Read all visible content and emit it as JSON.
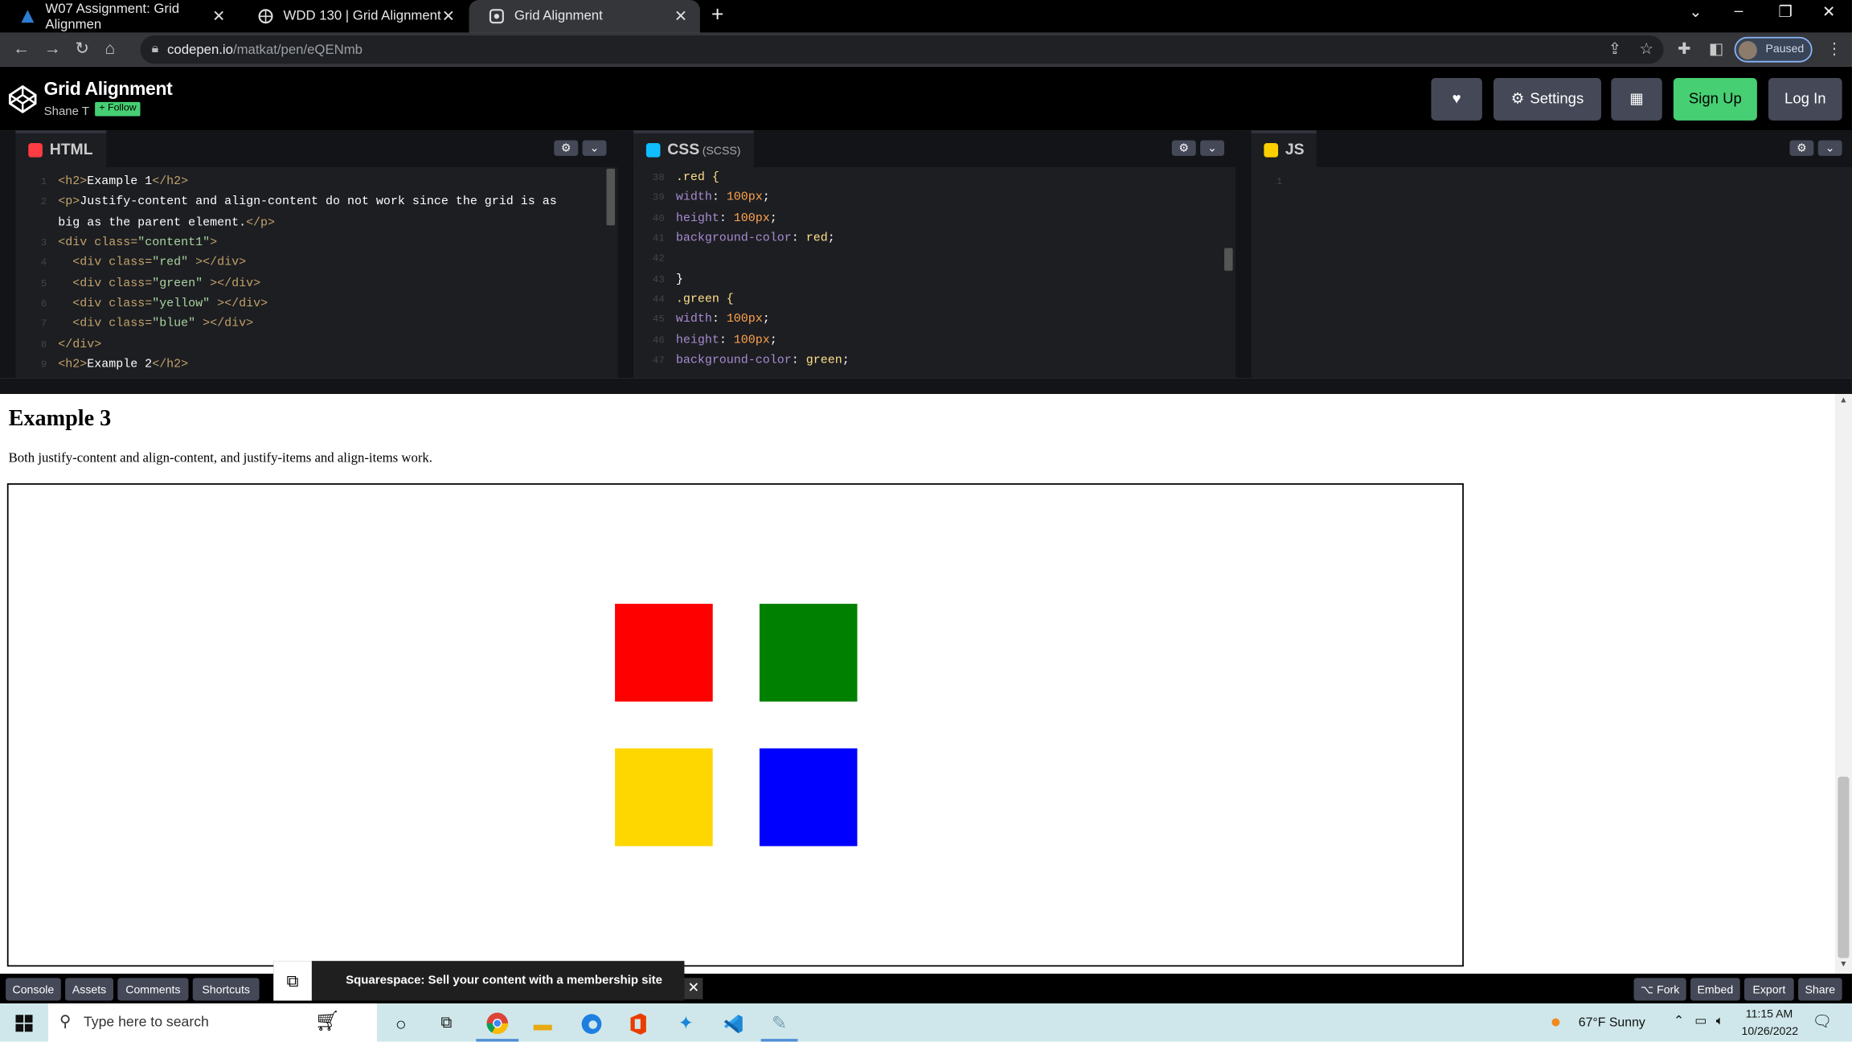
{
  "browser": {
    "tabs": [
      {
        "title": "W07 Assignment: Grid Alignmen"
      },
      {
        "title": "WDD 130 | Grid Alignment"
      },
      {
        "title": "Grid Alignment"
      }
    ],
    "url_host": "codepen.io",
    "url_path": "/matkat/pen/eQENmb",
    "profile_status": "Paused"
  },
  "codepen": {
    "title": "Grid Alignment",
    "author": "Shane T",
    "follow_label": "+ Follow",
    "settings_label": "Settings",
    "signup_label": "Sign Up",
    "login_label": "Log In",
    "html_tab": "HTML",
    "css_tab": "CSS",
    "css_sub": "(SCSS)",
    "js_tab": "JS"
  },
  "html_code": [
    {
      "ln": "1",
      "parts": [
        [
          "tag",
          "<h2>"
        ],
        [
          "txt",
          "Example 1"
        ],
        [
          "tag",
          "</h2>"
        ]
      ]
    },
    {
      "ln": "2",
      "parts": [
        [
          "tag",
          "<p>"
        ],
        [
          "txt",
          "Justify-content and align-content do not work since the grid is as"
        ]
      ]
    },
    {
      "ln": "",
      "parts": [
        [
          "txt",
          "big as the parent element."
        ],
        [
          "tag",
          "</p>"
        ]
      ]
    },
    {
      "ln": "3",
      "parts": [
        [
          "tag",
          "<div "
        ],
        [
          "attr",
          "class="
        ],
        [
          "str",
          "\"content1\""
        ],
        [
          "tag",
          ">"
        ]
      ]
    },
    {
      "ln": "4",
      "parts": [
        [
          "tag",
          "  <div "
        ],
        [
          "attr",
          "class="
        ],
        [
          "str",
          "\"red\""
        ],
        [
          "tag",
          " ></div>"
        ]
      ]
    },
    {
      "ln": "5",
      "parts": [
        [
          "tag",
          "  <div "
        ],
        [
          "attr",
          "class="
        ],
        [
          "str",
          "\"green\""
        ],
        [
          "tag",
          " ></div>"
        ]
      ]
    },
    {
      "ln": "6",
      "parts": [
        [
          "tag",
          "  <div "
        ],
        [
          "attr",
          "class="
        ],
        [
          "str",
          "\"yellow\""
        ],
        [
          "tag",
          " ></div>"
        ]
      ]
    },
    {
      "ln": "7",
      "parts": [
        [
          "tag",
          "  <div "
        ],
        [
          "attr",
          "class="
        ],
        [
          "str",
          "\"blue\""
        ],
        [
          "tag",
          " ></div>"
        ]
      ]
    },
    {
      "ln": "8",
      "parts": [
        [
          "tag",
          "</div>"
        ]
      ]
    },
    {
      "ln": "9",
      "parts": [
        [
          "tag",
          "<h2>"
        ],
        [
          "txt",
          "Example 2"
        ],
        [
          "tag",
          "</h2>"
        ]
      ]
    }
  ],
  "css_code": [
    {
      "ln": "38",
      "parts": [
        [
          "sel",
          ".red {"
        ]
      ]
    },
    {
      "ln": "39",
      "parts": [
        [
          "prop",
          "width"
        ],
        [
          "txt",
          ": "
        ],
        [
          "num",
          "100px"
        ],
        [
          "txt",
          ";"
        ]
      ]
    },
    {
      "ln": "40",
      "parts": [
        [
          "prop",
          "height"
        ],
        [
          "txt",
          ": "
        ],
        [
          "num",
          "100px"
        ],
        [
          "txt",
          ";"
        ]
      ]
    },
    {
      "ln": "41",
      "parts": [
        [
          "prop",
          "background-color"
        ],
        [
          "txt",
          ": "
        ],
        [
          "sel",
          "red"
        ],
        [
          "txt",
          ";"
        ]
      ]
    },
    {
      "ln": "42",
      "parts": []
    },
    {
      "ln": "43",
      "parts": [
        [
          "txt",
          "}"
        ]
      ]
    },
    {
      "ln": "44",
      "parts": [
        [
          "sel",
          ".green {"
        ]
      ]
    },
    {
      "ln": "45",
      "parts": [
        [
          "prop",
          "width"
        ],
        [
          "txt",
          ": "
        ],
        [
          "num",
          "100px"
        ],
        [
          "txt",
          ";"
        ]
      ]
    },
    {
      "ln": "46",
      "parts": [
        [
          "prop",
          "height"
        ],
        [
          "txt",
          ": "
        ],
        [
          "num",
          "100px"
        ],
        [
          "txt",
          ";"
        ]
      ]
    },
    {
      "ln": "47",
      "parts": [
        [
          "prop",
          "background-color"
        ],
        [
          "txt",
          ": "
        ],
        [
          "sel",
          "green"
        ],
        [
          "txt",
          ";"
        ]
      ]
    }
  ],
  "js_code": [
    {
      "ln": "1",
      "parts": []
    }
  ],
  "preview": {
    "heading": "Example 3",
    "text": "Both justify-content and align-content, and justify-items and align-items work.",
    "squares": [
      {
        "name": "red",
        "color": "#ff0000"
      },
      {
        "name": "green",
        "color": "#008000"
      },
      {
        "name": "yellow",
        "color": "#ffd700"
      },
      {
        "name": "blue",
        "color": "#0000ff"
      }
    ]
  },
  "bottom": {
    "left_buttons": [
      "Console",
      "Assets",
      "Comments",
      "Shortcuts"
    ],
    "ad_text": "Squarespace: Sell your content with a membership site",
    "right_buttons": [
      "⌥ Fork",
      "Embed",
      "Export",
      "Share"
    ]
  },
  "taskbar": {
    "search_placeholder": "Type here to search",
    "weather": "67°F  Sunny",
    "time": "11:15 AM",
    "date": "10/26/2022"
  },
  "colors": {
    "codepen_green": "#47cf73",
    "header_button": "#444857"
  }
}
